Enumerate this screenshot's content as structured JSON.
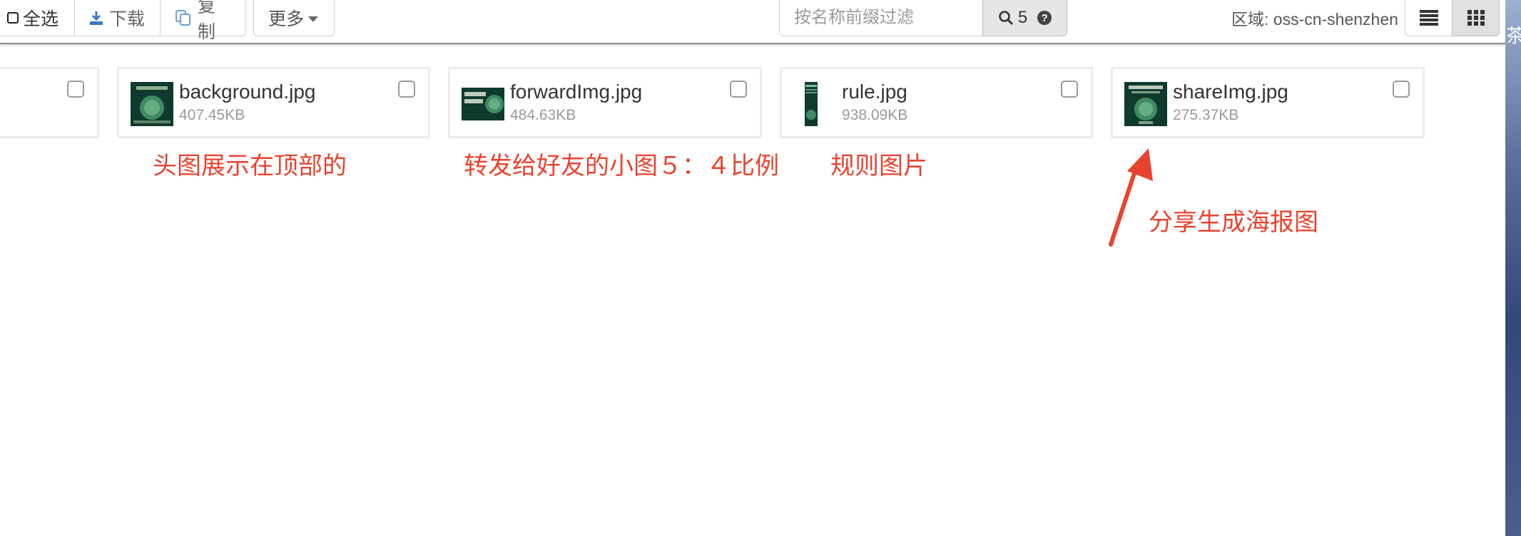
{
  "toolbar": {
    "select_all": "全选",
    "download": "下载",
    "copy": "复制",
    "more": "更多",
    "search_placeholder": "按名称前缀过滤",
    "search_count": "5",
    "region": "区域: oss-cn-shenzhen"
  },
  "files": [
    {
      "name": "background.jpg",
      "size": "407.45KB"
    },
    {
      "name": "forwardImg.jpg",
      "size": "484.63KB"
    },
    {
      "name": "rule.jpg",
      "size": "938.09KB"
    },
    {
      "name": "shareImg.jpg",
      "size": "275.37KB"
    }
  ],
  "annotations": {
    "background": "头图展示在顶部的",
    "forward": "转发给好友的小图５：４比例",
    "rule": "规则图片",
    "share": "分享生成海报图"
  },
  "side_text": "茶",
  "colors": {
    "annotation": "#e8432f",
    "thumb_dark": "#0f3a2e",
    "thumb_light": "#3f8a63"
  }
}
